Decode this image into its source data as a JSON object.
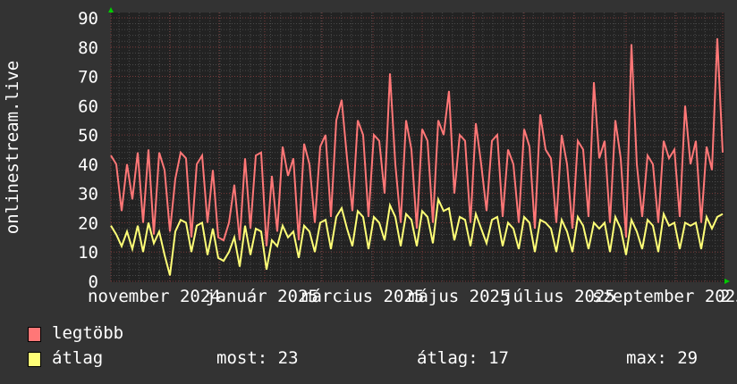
{
  "chart_data": {
    "type": "line",
    "ylabel": "onlinestream.live",
    "ylim": [
      0,
      90
    ],
    "yticks": [
      0,
      10,
      20,
      30,
      40,
      50,
      60,
      70,
      80,
      90
    ],
    "xticks": [
      "november 2024",
      "január 2025",
      "március 2025",
      "május 2025",
      "július 2025",
      "szeptember 2025",
      "2"
    ],
    "grid": true,
    "series": [
      {
        "name": "legtöbb",
        "color": "#ff7777",
        "values": [
          43,
          40,
          24,
          40,
          28,
          44,
          20,
          45,
          16,
          44,
          38,
          17,
          35,
          44,
          42,
          15,
          40,
          43,
          20,
          38,
          15,
          14,
          20,
          33,
          14,
          42,
          18,
          43,
          44,
          12,
          36,
          17,
          46,
          36,
          42,
          14,
          47,
          40,
          20,
          46,
          50,
          22,
          55,
          62,
          42,
          24,
          55,
          50,
          22,
          50,
          48,
          30,
          71,
          40,
          20,
          55,
          45,
          18,
          52,
          48,
          20,
          55,
          50,
          65,
          30,
          50,
          48,
          20,
          54,
          40,
          24,
          48,
          50,
          22,
          45,
          40,
          20,
          52,
          46,
          18,
          57,
          45,
          42,
          20,
          50,
          40,
          18,
          48,
          45,
          22,
          68,
          42,
          48,
          20,
          55,
          42,
          15,
          81,
          40,
          22,
          43,
          40,
          20,
          48,
          42,
          45,
          22,
          60,
          40,
          48,
          20,
          46,
          38,
          83,
          44
        ]
      },
      {
        "name": "átlag",
        "color": "#ffff77",
        "values": [
          19,
          16,
          12,
          17,
          11,
          19,
          10,
          20,
          13,
          17,
          9,
          2,
          17,
          21,
          20,
          10,
          19,
          20,
          9,
          18,
          8,
          7,
          10,
          15,
          5,
          19,
          9,
          18,
          17,
          4,
          14,
          12,
          19,
          15,
          17,
          8,
          19,
          17,
          10,
          20,
          21,
          11,
          22,
          25,
          18,
          12,
          24,
          22,
          11,
          22,
          20,
          14,
          26,
          22,
          12,
          23,
          21,
          12,
          24,
          22,
          13,
          28,
          24,
          25,
          14,
          22,
          21,
          12,
          23,
          18,
          13,
          21,
          22,
          12,
          20,
          18,
          11,
          22,
          20,
          10,
          21,
          20,
          18,
          10,
          21,
          17,
          10,
          22,
          19,
          11,
          20,
          18,
          20,
          10,
          22,
          18,
          9,
          21,
          17,
          11,
          21,
          19,
          10,
          23,
          19,
          20,
          11,
          20,
          19,
          20,
          11,
          22,
          18,
          22,
          23
        ]
      }
    ]
  },
  "legend": {
    "max_label": "legtöbb",
    "avg_label": "átlag",
    "now": "most: 23",
    "average": "átlag: 17",
    "maximum": "max: 29"
  }
}
